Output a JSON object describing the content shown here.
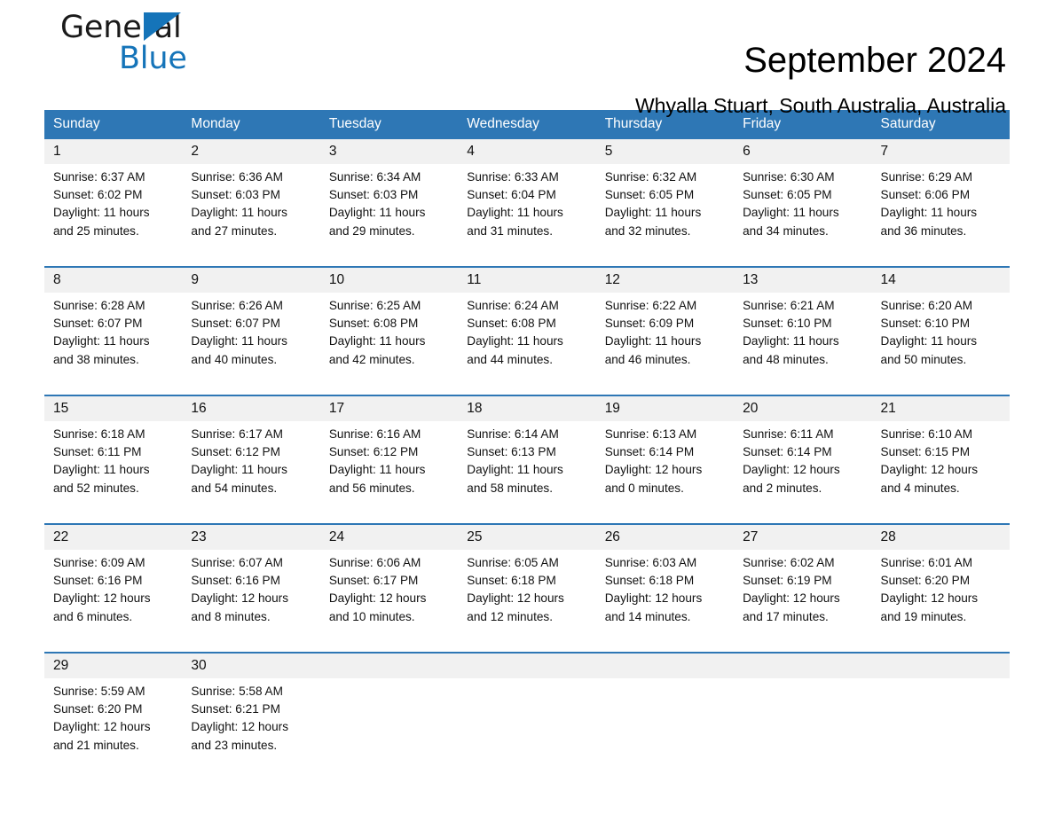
{
  "brand": {
    "name_part1": "General",
    "name_part2": "Blue",
    "accent_color": "#1574b9"
  },
  "header": {
    "month_title": "September 2024",
    "location": "Whyalla Stuart, South Australia, Australia"
  },
  "theme": {
    "header_blue": "#2e77b5",
    "daynum_band": "#f1f1f1",
    "text": "#111111"
  },
  "weekday_headers": [
    "Sunday",
    "Monday",
    "Tuesday",
    "Wednesday",
    "Thursday",
    "Friday",
    "Saturday"
  ],
  "weeks": [
    {
      "days": [
        {
          "num": "1",
          "sunrise": "Sunrise: 6:37 AM",
          "sunset": "Sunset: 6:02 PM",
          "daylight1": "Daylight: 11 hours",
          "daylight2": "and 25 minutes."
        },
        {
          "num": "2",
          "sunrise": "Sunrise: 6:36 AM",
          "sunset": "Sunset: 6:03 PM",
          "daylight1": "Daylight: 11 hours",
          "daylight2": "and 27 minutes."
        },
        {
          "num": "3",
          "sunrise": "Sunrise: 6:34 AM",
          "sunset": "Sunset: 6:03 PM",
          "daylight1": "Daylight: 11 hours",
          "daylight2": "and 29 minutes."
        },
        {
          "num": "4",
          "sunrise": "Sunrise: 6:33 AM",
          "sunset": "Sunset: 6:04 PM",
          "daylight1": "Daylight: 11 hours",
          "daylight2": "and 31 minutes."
        },
        {
          "num": "5",
          "sunrise": "Sunrise: 6:32 AM",
          "sunset": "Sunset: 6:05 PM",
          "daylight1": "Daylight: 11 hours",
          "daylight2": "and 32 minutes."
        },
        {
          "num": "6",
          "sunrise": "Sunrise: 6:30 AM",
          "sunset": "Sunset: 6:05 PM",
          "daylight1": "Daylight: 11 hours",
          "daylight2": "and 34 minutes."
        },
        {
          "num": "7",
          "sunrise": "Sunrise: 6:29 AM",
          "sunset": "Sunset: 6:06 PM",
          "daylight1": "Daylight: 11 hours",
          "daylight2": "and 36 minutes."
        }
      ]
    },
    {
      "days": [
        {
          "num": "8",
          "sunrise": "Sunrise: 6:28 AM",
          "sunset": "Sunset: 6:07 PM",
          "daylight1": "Daylight: 11 hours",
          "daylight2": "and 38 minutes."
        },
        {
          "num": "9",
          "sunrise": "Sunrise: 6:26 AM",
          "sunset": "Sunset: 6:07 PM",
          "daylight1": "Daylight: 11 hours",
          "daylight2": "and 40 minutes."
        },
        {
          "num": "10",
          "sunrise": "Sunrise: 6:25 AM",
          "sunset": "Sunset: 6:08 PM",
          "daylight1": "Daylight: 11 hours",
          "daylight2": "and 42 minutes."
        },
        {
          "num": "11",
          "sunrise": "Sunrise: 6:24 AM",
          "sunset": "Sunset: 6:08 PM",
          "daylight1": "Daylight: 11 hours",
          "daylight2": "and 44 minutes."
        },
        {
          "num": "12",
          "sunrise": "Sunrise: 6:22 AM",
          "sunset": "Sunset: 6:09 PM",
          "daylight1": "Daylight: 11 hours",
          "daylight2": "and 46 minutes."
        },
        {
          "num": "13",
          "sunrise": "Sunrise: 6:21 AM",
          "sunset": "Sunset: 6:10 PM",
          "daylight1": "Daylight: 11 hours",
          "daylight2": "and 48 minutes."
        },
        {
          "num": "14",
          "sunrise": "Sunrise: 6:20 AM",
          "sunset": "Sunset: 6:10 PM",
          "daylight1": "Daylight: 11 hours",
          "daylight2": "and 50 minutes."
        }
      ]
    },
    {
      "days": [
        {
          "num": "15",
          "sunrise": "Sunrise: 6:18 AM",
          "sunset": "Sunset: 6:11 PM",
          "daylight1": "Daylight: 11 hours",
          "daylight2": "and 52 minutes."
        },
        {
          "num": "16",
          "sunrise": "Sunrise: 6:17 AM",
          "sunset": "Sunset: 6:12 PM",
          "daylight1": "Daylight: 11 hours",
          "daylight2": "and 54 minutes."
        },
        {
          "num": "17",
          "sunrise": "Sunrise: 6:16 AM",
          "sunset": "Sunset: 6:12 PM",
          "daylight1": "Daylight: 11 hours",
          "daylight2": "and 56 minutes."
        },
        {
          "num": "18",
          "sunrise": "Sunrise: 6:14 AM",
          "sunset": "Sunset: 6:13 PM",
          "daylight1": "Daylight: 11 hours",
          "daylight2": "and 58 minutes."
        },
        {
          "num": "19",
          "sunrise": "Sunrise: 6:13 AM",
          "sunset": "Sunset: 6:14 PM",
          "daylight1": "Daylight: 12 hours",
          "daylight2": "and 0 minutes."
        },
        {
          "num": "20",
          "sunrise": "Sunrise: 6:11 AM",
          "sunset": "Sunset: 6:14 PM",
          "daylight1": "Daylight: 12 hours",
          "daylight2": "and 2 minutes."
        },
        {
          "num": "21",
          "sunrise": "Sunrise: 6:10 AM",
          "sunset": "Sunset: 6:15 PM",
          "daylight1": "Daylight: 12 hours",
          "daylight2": "and 4 minutes."
        }
      ]
    },
    {
      "days": [
        {
          "num": "22",
          "sunrise": "Sunrise: 6:09 AM",
          "sunset": "Sunset: 6:16 PM",
          "daylight1": "Daylight: 12 hours",
          "daylight2": "and 6 minutes."
        },
        {
          "num": "23",
          "sunrise": "Sunrise: 6:07 AM",
          "sunset": "Sunset: 6:16 PM",
          "daylight1": "Daylight: 12 hours",
          "daylight2": "and 8 minutes."
        },
        {
          "num": "24",
          "sunrise": "Sunrise: 6:06 AM",
          "sunset": "Sunset: 6:17 PM",
          "daylight1": "Daylight: 12 hours",
          "daylight2": "and 10 minutes."
        },
        {
          "num": "25",
          "sunrise": "Sunrise: 6:05 AM",
          "sunset": "Sunset: 6:18 PM",
          "daylight1": "Daylight: 12 hours",
          "daylight2": "and 12 minutes."
        },
        {
          "num": "26",
          "sunrise": "Sunrise: 6:03 AM",
          "sunset": "Sunset: 6:18 PM",
          "daylight1": "Daylight: 12 hours",
          "daylight2": "and 14 minutes."
        },
        {
          "num": "27",
          "sunrise": "Sunrise: 6:02 AM",
          "sunset": "Sunset: 6:19 PM",
          "daylight1": "Daylight: 12 hours",
          "daylight2": "and 17 minutes."
        },
        {
          "num": "28",
          "sunrise": "Sunrise: 6:01 AM",
          "sunset": "Sunset: 6:20 PM",
          "daylight1": "Daylight: 12 hours",
          "daylight2": "and 19 minutes."
        }
      ]
    },
    {
      "days": [
        {
          "num": "29",
          "sunrise": "Sunrise: 5:59 AM",
          "sunset": "Sunset: 6:20 PM",
          "daylight1": "Daylight: 12 hours",
          "daylight2": "and 21 minutes."
        },
        {
          "num": "30",
          "sunrise": "Sunrise: 5:58 AM",
          "sunset": "Sunset: 6:21 PM",
          "daylight1": "Daylight: 12 hours",
          "daylight2": "and 23 minutes."
        },
        {
          "num": "",
          "sunrise": "",
          "sunset": "",
          "daylight1": "",
          "daylight2": ""
        },
        {
          "num": "",
          "sunrise": "",
          "sunset": "",
          "daylight1": "",
          "daylight2": ""
        },
        {
          "num": "",
          "sunrise": "",
          "sunset": "",
          "daylight1": "",
          "daylight2": ""
        },
        {
          "num": "",
          "sunrise": "",
          "sunset": "",
          "daylight1": "",
          "daylight2": ""
        },
        {
          "num": "",
          "sunrise": "",
          "sunset": "",
          "daylight1": "",
          "daylight2": ""
        }
      ]
    }
  ]
}
